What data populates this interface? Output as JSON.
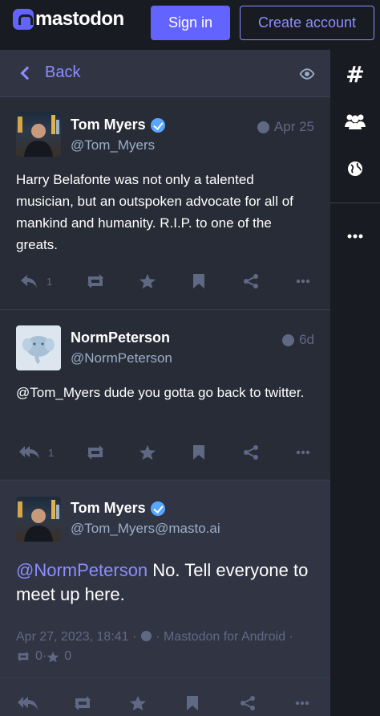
{
  "header": {
    "logo_text": "mastodon",
    "signin_label": "Sign in",
    "create_label": "Create account"
  },
  "nav": {
    "back_label": "Back"
  },
  "statuses": [
    {
      "display_name": "Tom Myers",
      "verified": true,
      "acct": "@Tom_Myers",
      "time": "Apr 25",
      "content": "Harry Belafonte was not only a talented musician, but an outspoken advocate for all of mankind and humanity. R.I.P. to one of the greats.",
      "replies": "1"
    },
    {
      "display_name": "NormPeterson",
      "verified": false,
      "acct": "@NormPeterson",
      "time": "6d",
      "content": "@Tom_Myers dude you gotta go back to twitter.",
      "replies": "1"
    },
    {
      "display_name": "Tom Myers",
      "verified": true,
      "acct": "@Tom_Myers@masto.ai",
      "content_mention": "@NormPeterson",
      "content_rest": " No. Tell everyone to meet up here.",
      "date": "Apr 27, 2023, 18:41",
      "sep1": " · ",
      "sep2": " · ",
      "application": "Mastodon for Android",
      "sep3": " ·",
      "boosts": "0",
      "sep4": " · ",
      "favourites": "0"
    }
  ],
  "colors": {
    "accent": "#6364ff",
    "link": "#8c8dff",
    "muted": "#606984",
    "bg": "#282c37"
  }
}
